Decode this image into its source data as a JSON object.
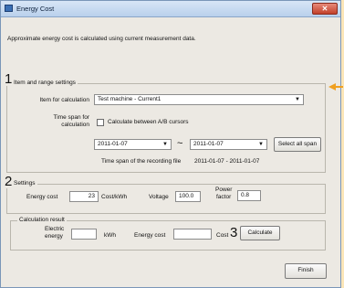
{
  "window": {
    "title": "Energy Cost",
    "close_glyph": "✕"
  },
  "description": "Approximate energy cost is calculated using current measurement data.",
  "annotations": {
    "n1": "1",
    "n2": "2",
    "n3": "3"
  },
  "item_range": {
    "group_label": "Item and range settings",
    "item_label": "Item for calculation",
    "item_value": "Test machine - Current1",
    "timespan_label_line1": "Time span for",
    "timespan_label_line2": "calculation",
    "checkbox_label": "Calculate between A/B cursors",
    "start_date": "2011-01-07",
    "range_sep": "~",
    "end_date": "2011-01-07",
    "select_all_label": "Select all span",
    "recording_label": "Time span of the recording file",
    "recording_value": "2011-01-07 - 2011-01-07"
  },
  "settings": {
    "group_label": "Settings",
    "energy_cost_label": "Energy cost",
    "energy_cost_value": "23",
    "energy_cost_unit": "Cost/kWh",
    "voltage_label": "Voltage",
    "voltage_value": "100.0",
    "power_factor_line1": "Power",
    "power_factor_line2": "factor",
    "power_factor_value": "0.8"
  },
  "result": {
    "group_label": "Calculation result",
    "electric_energy_line1": "Electric",
    "electric_energy_line2": "energy",
    "energy_value": "",
    "energy_unit": "kWh",
    "cost_label": "Energy cost",
    "cost_value": "",
    "cost_unit": "Cost",
    "calculate_label": "Calculate"
  },
  "footer": {
    "finish_label": "Finish"
  },
  "colors": {
    "background": "#fbe6b8",
    "callout": "#f0a020"
  }
}
